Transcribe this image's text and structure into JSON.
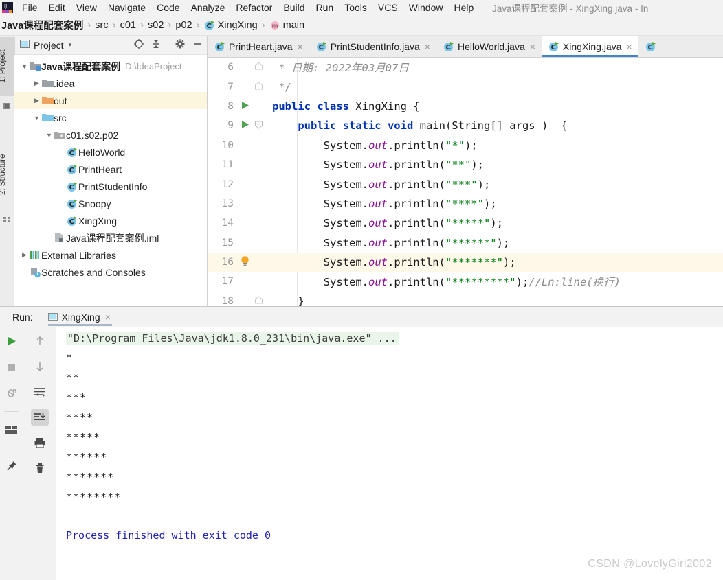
{
  "window": {
    "title": "Java课程配套案例 - XingXing.java - In"
  },
  "menubar": {
    "items": [
      {
        "label": "File",
        "mnemonic": "F"
      },
      {
        "label": "Edit",
        "mnemonic": "E"
      },
      {
        "label": "View",
        "mnemonic": "V"
      },
      {
        "label": "Navigate",
        "mnemonic": "N"
      },
      {
        "label": "Code",
        "mnemonic": "C"
      },
      {
        "label": "Analyze",
        "mnemonic": "z"
      },
      {
        "label": "Refactor",
        "mnemonic": "R"
      },
      {
        "label": "Build",
        "mnemonic": "B"
      },
      {
        "label": "Run",
        "mnemonic": "R"
      },
      {
        "label": "Tools",
        "mnemonic": "T"
      },
      {
        "label": "VCS",
        "mnemonic": "S"
      },
      {
        "label": "Window",
        "mnemonic": "W"
      },
      {
        "label": "Help",
        "mnemonic": "H"
      }
    ]
  },
  "breadcrumb": {
    "items": [
      {
        "label": "Java课程配套案例",
        "icon": "none",
        "bold": true
      },
      {
        "label": "src",
        "icon": "none",
        "bold": false
      },
      {
        "label": "c01",
        "icon": "none",
        "bold": false
      },
      {
        "label": "s02",
        "icon": "none",
        "bold": false
      },
      {
        "label": "p02",
        "icon": "none",
        "bold": false
      },
      {
        "label": "XingXing",
        "icon": "java-class-icon",
        "bold": false
      },
      {
        "label": "main",
        "icon": "method-icon",
        "bold": false
      }
    ],
    "separator": "›"
  },
  "stripe": {
    "tabs": [
      {
        "label": "1: Project",
        "selected": true,
        "icon": "project-stripe-icon"
      },
      {
        "label": "2: Structure",
        "selected": false,
        "icon": "structure-stripe-icon"
      }
    ]
  },
  "project_panel": {
    "title": "Project",
    "caret": "▾",
    "actions": [
      {
        "name": "locate-icon",
        "tooltip": "Select Opened File"
      },
      {
        "name": "collapse-all-icon",
        "tooltip": "Collapse All"
      },
      {
        "name": "gear-icon",
        "tooltip": "Settings"
      },
      {
        "name": "minimize-icon",
        "tooltip": "Hide"
      }
    ],
    "tree": [
      {
        "label": "Java课程配套案例",
        "path": "D:\\IdeaProject",
        "indent": 0,
        "arrow": "down",
        "icon": "module-icon",
        "bold": true,
        "highlight": false
      },
      {
        "label": ".idea",
        "path": "",
        "indent": 1,
        "arrow": "right",
        "icon": "folder-grey-icon",
        "bold": false,
        "highlight": false
      },
      {
        "label": "out",
        "path": "",
        "indent": 1,
        "arrow": "right",
        "icon": "folder-orange-icon",
        "bold": false,
        "highlight": true
      },
      {
        "label": "src",
        "path": "",
        "indent": 1,
        "arrow": "down",
        "icon": "folder-blue-icon",
        "bold": false,
        "highlight": false
      },
      {
        "label": "c01.s02.p02",
        "path": "",
        "indent": 2,
        "arrow": "down",
        "icon": "package-icon",
        "bold": false,
        "highlight": false
      },
      {
        "label": "HelloWorld",
        "path": "",
        "indent": 3,
        "arrow": "none",
        "icon": "java-class-icon",
        "bold": false,
        "highlight": false
      },
      {
        "label": "PrintHeart",
        "path": "",
        "indent": 3,
        "arrow": "none",
        "icon": "java-class-icon",
        "bold": false,
        "highlight": false
      },
      {
        "label": "PrintStudentInfo",
        "path": "",
        "indent": 3,
        "arrow": "none",
        "icon": "java-class-icon",
        "bold": false,
        "highlight": false
      },
      {
        "label": "Snoopy",
        "path": "",
        "indent": 3,
        "arrow": "none",
        "icon": "java-class-icon",
        "bold": false,
        "highlight": false
      },
      {
        "label": "XingXing",
        "path": "",
        "indent": 3,
        "arrow": "none",
        "icon": "java-class-icon",
        "bold": false,
        "highlight": false
      },
      {
        "label": "Java课程配套案例.iml",
        "path": "",
        "indent": 2,
        "arrow": "none",
        "icon": "iml-icon",
        "bold": false,
        "highlight": false
      },
      {
        "label": "External Libraries",
        "path": "",
        "indent": 0,
        "arrow": "right",
        "icon": "libraries-icon",
        "bold": false,
        "highlight": false
      },
      {
        "label": "Scratches and Consoles",
        "path": "",
        "indent": 0,
        "arrow": "none",
        "icon": "scratches-icon",
        "bold": false,
        "highlight": false
      }
    ]
  },
  "editor": {
    "tabs": [
      {
        "label": "PrintHeart.java",
        "active": false,
        "icon": "java-class-icon"
      },
      {
        "label": "PrintStudentInfo.java",
        "active": false,
        "icon": "java-class-icon"
      },
      {
        "label": "HelloWorld.java",
        "active": false,
        "icon": "java-class-icon"
      },
      {
        "label": "XingXing.java",
        "active": true,
        "icon": "java-class-icon"
      },
      {
        "label": "",
        "active": false,
        "icon": "java-class-icon"
      }
    ],
    "close_glyph": "×",
    "lines": [
      {
        "num": "6",
        "gutter_run": false,
        "fold": "end",
        "highlight": false,
        "bulb": false,
        "tokens": [
          {
            "t": " * 日期: 2022年03月07日",
            "c": "cmt"
          }
        ]
      },
      {
        "num": "7",
        "gutter_run": false,
        "fold": "endcap",
        "highlight": false,
        "bulb": false,
        "tokens": [
          {
            "t": " */",
            "c": "cmt"
          }
        ]
      },
      {
        "num": "8",
        "gutter_run": true,
        "fold": "none",
        "highlight": false,
        "bulb": false,
        "tokens": [
          {
            "t": "public class ",
            "c": "kw"
          },
          {
            "t": "XingXing {",
            "c": "plain"
          }
        ]
      },
      {
        "num": "9",
        "gutter_run": true,
        "fold": "start",
        "highlight": false,
        "bulb": false,
        "tokens": [
          {
            "t": "    ",
            "c": "plain"
          },
          {
            "t": "public static void ",
            "c": "kw"
          },
          {
            "t": "main",
            "c": "mth"
          },
          {
            "t": "(String[] args )  {",
            "c": "plain"
          }
        ]
      },
      {
        "num": "10",
        "gutter_run": false,
        "fold": "none",
        "highlight": false,
        "bulb": false,
        "tokens": [
          {
            "t": "        System.",
            "c": "plain"
          },
          {
            "t": "out",
            "c": "fld"
          },
          {
            "t": ".println(",
            "c": "plain"
          },
          {
            "t": "\"*\"",
            "c": "str"
          },
          {
            "t": ");",
            "c": "plain"
          }
        ]
      },
      {
        "num": "11",
        "gutter_run": false,
        "fold": "none",
        "highlight": false,
        "bulb": false,
        "tokens": [
          {
            "t": "        System.",
            "c": "plain"
          },
          {
            "t": "out",
            "c": "fld"
          },
          {
            "t": ".println(",
            "c": "plain"
          },
          {
            "t": "\"**\"",
            "c": "str"
          },
          {
            "t": ");",
            "c": "plain"
          }
        ]
      },
      {
        "num": "12",
        "gutter_run": false,
        "fold": "none",
        "highlight": false,
        "bulb": false,
        "tokens": [
          {
            "t": "        System.",
            "c": "plain"
          },
          {
            "t": "out",
            "c": "fld"
          },
          {
            "t": ".println(",
            "c": "plain"
          },
          {
            "t": "\"***\"",
            "c": "str"
          },
          {
            "t": ");",
            "c": "plain"
          }
        ]
      },
      {
        "num": "13",
        "gutter_run": false,
        "fold": "none",
        "highlight": false,
        "bulb": false,
        "tokens": [
          {
            "t": "        System.",
            "c": "plain"
          },
          {
            "t": "out",
            "c": "fld"
          },
          {
            "t": ".println(",
            "c": "plain"
          },
          {
            "t": "\"****\"",
            "c": "str"
          },
          {
            "t": ");",
            "c": "plain"
          }
        ]
      },
      {
        "num": "14",
        "gutter_run": false,
        "fold": "none",
        "highlight": false,
        "bulb": false,
        "tokens": [
          {
            "t": "        System.",
            "c": "plain"
          },
          {
            "t": "out",
            "c": "fld"
          },
          {
            "t": ".println(",
            "c": "plain"
          },
          {
            "t": "\"*****\"",
            "c": "str"
          },
          {
            "t": ");",
            "c": "plain"
          }
        ]
      },
      {
        "num": "15",
        "gutter_run": false,
        "fold": "none",
        "highlight": false,
        "bulb": false,
        "tokens": [
          {
            "t": "        System.",
            "c": "plain"
          },
          {
            "t": "out",
            "c": "fld"
          },
          {
            "t": ".println(",
            "c": "plain"
          },
          {
            "t": "\"******\"",
            "c": "str"
          },
          {
            "t": ");",
            "c": "plain"
          }
        ]
      },
      {
        "num": "16",
        "gutter_run": false,
        "fold": "none",
        "highlight": true,
        "bulb": true,
        "tokens": [
          {
            "t": "        System.",
            "c": "plain"
          },
          {
            "t": "out",
            "c": "fld"
          },
          {
            "t": ".println(",
            "c": "plain"
          },
          {
            "t": "\"*",
            "c": "str"
          },
          {
            "t": "|CARET|",
            "c": "caret"
          },
          {
            "t": "******\"",
            "c": "str"
          },
          {
            "t": ");",
            "c": "plain"
          }
        ]
      },
      {
        "num": "17",
        "gutter_run": false,
        "fold": "none",
        "highlight": false,
        "bulb": false,
        "tokens": [
          {
            "t": "        System.",
            "c": "plain"
          },
          {
            "t": "out",
            "c": "fld"
          },
          {
            "t": ".println(",
            "c": "plain"
          },
          {
            "t": "\"*********\"",
            "c": "str"
          },
          {
            "t": ");",
            "c": "plain"
          },
          {
            "t": "//Ln:line(换行)",
            "c": "cmt"
          }
        ]
      },
      {
        "num": "18",
        "gutter_run": false,
        "fold": "endcap",
        "highlight": false,
        "bulb": false,
        "tokens": [
          {
            "t": "    }",
            "c": "plain"
          }
        ]
      }
    ]
  },
  "run_panel": {
    "label": "Run:",
    "tab_name": "XingXing",
    "close_glyph": "×",
    "tools_left": [
      {
        "name": "rerun-icon",
        "selected": false
      },
      {
        "name": "stop-icon",
        "selected": false
      },
      {
        "name": "debug-rerun-icon",
        "selected": false
      },
      {
        "name": "layout-icon",
        "selected": false
      },
      {
        "name": "pin-icon",
        "selected": false
      }
    ],
    "tools_right": [
      {
        "name": "arrow-up-icon",
        "selected": false
      },
      {
        "name": "arrow-down-icon",
        "selected": false
      },
      {
        "name": "soft-wrap-icon",
        "selected": false
      },
      {
        "name": "scroll-to-end-icon",
        "selected": true
      },
      {
        "name": "print-icon",
        "selected": false
      },
      {
        "name": "trash-icon",
        "selected": false
      }
    ],
    "console": {
      "command": "\"D:\\Program Files\\Java\\jdk1.8.0_231\\bin\\java.exe\" ...",
      "output": [
        "*",
        "**",
        "***",
        "****",
        "*****",
        "******",
        "*******",
        "********"
      ],
      "exit_message": "Process finished with exit code 0"
    }
  },
  "watermark": "CSDN @LovelyGirl2002"
}
